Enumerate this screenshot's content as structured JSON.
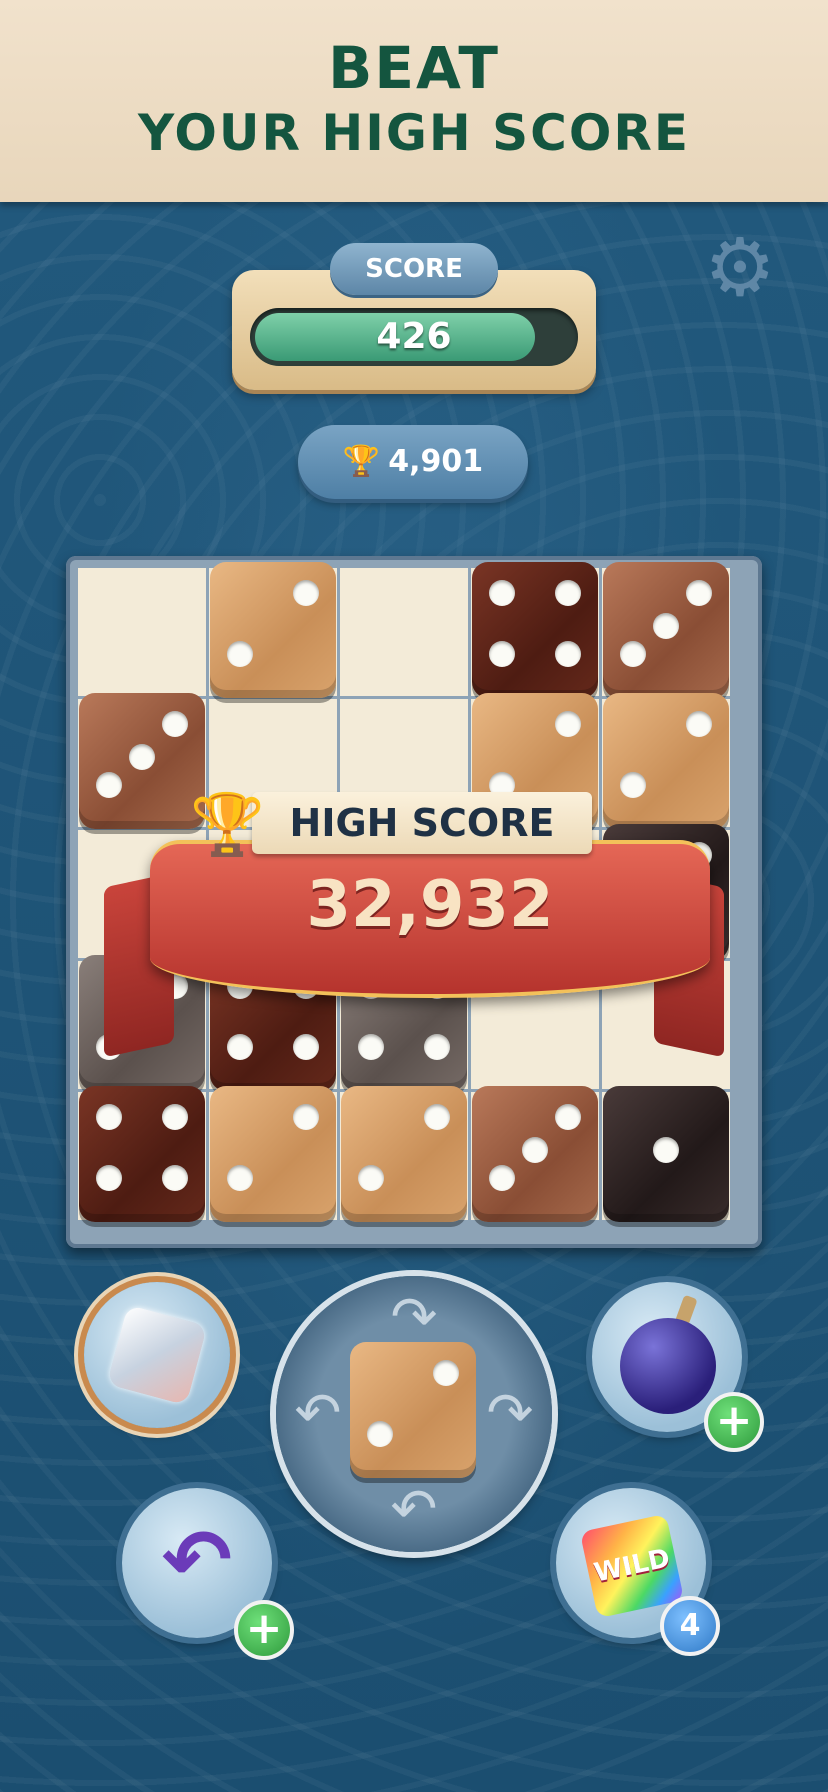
{
  "banner": {
    "line1": "BEAT",
    "line2": "YOUR HIGH SCORE"
  },
  "score": {
    "label": "SCORE",
    "value": "426",
    "fill_fraction": 0.88
  },
  "best": {
    "value": "4,901",
    "icon": "trophy-icon"
  },
  "settings": {
    "icon": "gear-icon"
  },
  "high_score": {
    "label": "HIGH SCORE",
    "value": "32,932",
    "icon": "trophy-icon"
  },
  "board": {
    "cols": 5,
    "rows": 5,
    "dice": [
      {
        "row": 0,
        "col": 1,
        "face": 2,
        "wood": "light"
      },
      {
        "row": 0,
        "col": 3,
        "face": 4,
        "wood": "dark"
      },
      {
        "row": 0,
        "col": 4,
        "face": 3,
        "wood": "mid"
      },
      {
        "row": 1,
        "col": 0,
        "face": 3,
        "wood": "mid"
      },
      {
        "row": 1,
        "col": 3,
        "face": 2,
        "wood": "light"
      },
      {
        "row": 1,
        "col": 4,
        "face": 2,
        "wood": "light"
      },
      {
        "row": 2,
        "col": 4,
        "face": 2,
        "wood": "black"
      },
      {
        "row": 3,
        "col": 0,
        "face": 2,
        "wood": "grey"
      },
      {
        "row": 3,
        "col": 1,
        "face": 4,
        "wood": "dark"
      },
      {
        "row": 3,
        "col": 2,
        "face": 4,
        "wood": "grey"
      },
      {
        "row": 4,
        "col": 0,
        "face": 4,
        "wood": "dark"
      },
      {
        "row": 4,
        "col": 1,
        "face": 2,
        "wood": "light"
      },
      {
        "row": 4,
        "col": 2,
        "face": 2,
        "wood": "light"
      },
      {
        "row": 4,
        "col": 3,
        "face": 3,
        "wood": "mid"
      },
      {
        "row": 4,
        "col": 4,
        "face": 1,
        "wood": "black"
      }
    ]
  },
  "next_piece": {
    "face": 2,
    "wood": "light"
  },
  "powerups": {
    "diamond": {
      "icon": "diamond-icon"
    },
    "bomb": {
      "icon": "bomb-icon",
      "badge": "+"
    },
    "undo": {
      "icon": "undo-icon",
      "badge": "+"
    },
    "wild": {
      "icon": "wild-card-icon",
      "label": "WILD",
      "count": "4"
    }
  }
}
